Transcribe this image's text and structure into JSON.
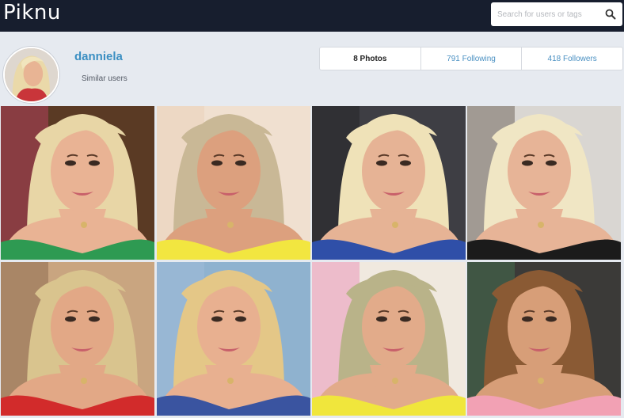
{
  "app": {
    "title": "Piknu"
  },
  "search": {
    "placeholder": "Search for users or tags",
    "icon": "search-icon"
  },
  "profile": {
    "username": "danniela",
    "similar_label": "Similar users",
    "stats": {
      "photos": "8 Photos",
      "following": "791 Following",
      "followers": "418 Followers"
    }
  },
  "colors": {
    "topbar": "#171e2e",
    "background": "#e6eaf0",
    "accent": "#3b8fc2"
  },
  "photos": [
    {
      "hair": "#e8d6a6",
      "skin": "#e9b394",
      "bg": "#5a3a24",
      "top": "#2e9a52",
      "accent": "#e2447a"
    },
    {
      "hair": "#c9b896",
      "skin": "#dca07e",
      "bg": "#f0e0d0",
      "top": "#f2e640",
      "accent": "#e8c9b0"
    },
    {
      "hair": "#efe2b8",
      "skin": "#e6b395",
      "bg": "#3e3e44",
      "top": "#2f4fa8",
      "accent": "#181818"
    },
    {
      "hair": "#f0e6c4",
      "skin": "#e7b497",
      "bg": "#d9d6d2",
      "top": "#1b1b1b",
      "accent": "#3a2a20"
    },
    {
      "hair": "#d9c48e",
      "skin": "#e2a886",
      "bg": "#c9a580",
      "top": "#d22b2b",
      "accent": "#6c4d37"
    },
    {
      "hair": "#e4c787",
      "skin": "#e8b090",
      "bg": "#8fb2cf",
      "top": "#3a54a0",
      "accent": "#a9bfdc"
    },
    {
      "hair": "#b9b389",
      "skin": "#e2ab8a",
      "bg": "#f0e9df",
      "top": "#f0e63c",
      "accent": "#e86aa7"
    },
    {
      "hair": "#8a5a34",
      "skin": "#d79e78",
      "bg": "#3b3a38",
      "top": "#f2a1b4",
      "accent": "#4b8c5c"
    }
  ]
}
